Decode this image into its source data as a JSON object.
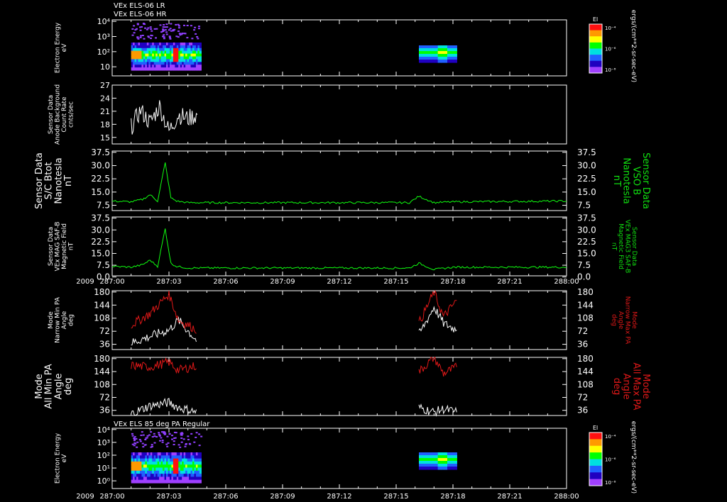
{
  "header": {
    "line1": "VEx ELS-06 LR",
    "line2": "VEx ELS-06 HR",
    "bottom_header": "VEx ELS 85 deg PA Regular"
  },
  "time_axis": {
    "year": "2009",
    "ticks": [
      "287:00",
      "287:03",
      "287:06",
      "287:09",
      "287:12",
      "287:15",
      "287:18",
      "287:21",
      "288:00"
    ]
  },
  "colorbar": {
    "label": "El",
    "units": "ergs/(cm**2-sr-sec-eV)",
    "ticks": [
      "10⁻⁴",
      "10⁻⁶",
      "10⁻⁸"
    ],
    "colors": [
      "#ff1010",
      "#ff9a00",
      "#ffff00",
      "#00ff00",
      "#00e0e0",
      "#2060ff",
      "#2000c0",
      "#a040ff"
    ]
  },
  "panels": [
    {
      "name": "electron-energy-top",
      "type": "spectrogram",
      "ylabel": [
        "Electron Energy",
        "eV"
      ],
      "yticks": [
        "10⁴",
        "10³",
        "10²",
        "10"
      ],
      "label_color": "#ffffff"
    },
    {
      "name": "anode-background",
      "type": "line",
      "ylabel": [
        "Sensor Data",
        "Anode Background",
        "Count Rate",
        "cnts/sec"
      ],
      "yticks": [
        "27",
        "24",
        "21",
        "18",
        "15"
      ],
      "ylim": [
        13,
        27
      ],
      "color": "#ffffff"
    },
    {
      "name": "sc-bnorm",
      "type": "line",
      "ylabel": [
        "Sensor Data",
        "S/C Btot",
        "Nanotesla",
        "nT"
      ],
      "yticks": [
        "37.5",
        "30.0",
        "22.5",
        "15.0",
        "7.5"
      ],
      "right_ticks": [
        "37.5",
        "30.0",
        "22.5",
        "15.0",
        "7.5"
      ],
      "right_label": [
        "Sensor Data",
        "VSO B",
        "Nanotesla",
        "nT"
      ],
      "ylim": [
        0,
        37.5
      ],
      "color": "#10ff10"
    },
    {
      "name": "mag-field",
      "type": "line",
      "ylabel": [
        "Sensor Data",
        "VEx MAG SAF-B",
        "Magnetic Field",
        "nT"
      ],
      "yticks": [
        "37.5",
        "30.0",
        "22.5",
        "15.0",
        "7.5",
        "0.0"
      ],
      "right_ticks": [
        "37.5",
        "30.0",
        "22.5",
        "15.0",
        "7.5",
        "0.0"
      ],
      "right_label": [
        "Sensor Data",
        "VEx MAG3 SAF-B",
        "Magnetic Field",
        "nT"
      ],
      "ylim": [
        0,
        37.5
      ],
      "color": "#10ff10"
    },
    {
      "name": "narrow-pa",
      "type": "line2",
      "ylabel": [
        "Mode",
        "Narrow Min PA",
        "Angle",
        "deg"
      ],
      "yticks": [
        "180",
        "144",
        "108",
        "72",
        "36"
      ],
      "right_ticks": [
        "180",
        "144",
        "108",
        "72",
        "36"
      ],
      "right_label": [
        "Mode",
        "Narrow Max PA",
        "Angle",
        "deg"
      ],
      "ylim": [
        0,
        180
      ]
    },
    {
      "name": "all-pa",
      "type": "line2",
      "ylabel": [
        "Mode",
        "All Min PA",
        "Angle",
        "deg"
      ],
      "yticks": [
        "180",
        "144",
        "108",
        "72",
        "36"
      ],
      "right_ticks": [
        "180",
        "144",
        "108",
        "72",
        "36"
      ],
      "right_label": [
        "Mode",
        "All Max PA",
        "Angle",
        "deg"
      ],
      "ylim": [
        0,
        180
      ]
    },
    {
      "name": "electron-energy-bottom",
      "type": "spectrogram",
      "ylabel": [
        "Electron Energy",
        "eV"
      ],
      "yticks": [
        "10⁴",
        "10³",
        "10²",
        "10¹",
        "10⁰"
      ],
      "label_color": "#ffffff"
    }
  ],
  "chart_data": {
    "type": "line",
    "x_range_hours": [
      0,
      24
    ],
    "series": [
      {
        "panel": "anode-background",
        "x": [
          1.0,
          1.5,
          2.0,
          2.5,
          3.0,
          3.5,
          4.0,
          4.5
        ],
        "y": [
          17,
          21,
          18,
          22,
          16,
          20,
          19,
          20
        ]
      },
      {
        "panel": "sc-bnorm",
        "x": [
          0,
          1.0,
          1.6,
          2.0,
          2.4,
          2.8,
          3.1,
          3.4,
          4.0,
          8,
          12,
          15.7,
          16.2,
          17.0,
          18,
          24
        ],
        "y": [
          6,
          5.5,
          7,
          10,
          6,
          30,
          8,
          6,
          5,
          5,
          5,
          5,
          9,
          5,
          5.5,
          6
        ]
      },
      {
        "panel": "mag-field",
        "x": [
          0,
          1.0,
          1.6,
          2.0,
          2.4,
          2.8,
          3.1,
          3.4,
          4.0,
          8,
          12,
          15.7,
          16.2,
          17.0,
          18,
          24
        ],
        "y": [
          6,
          5.5,
          7,
          10,
          6,
          30,
          8,
          6,
          5,
          5,
          5,
          5,
          8,
          4,
          5.5,
          5.5
        ]
      },
      {
        "panel": "narrow-pa",
        "name": "Narrow Min PA",
        "x": [
          1.0,
          2.0,
          3.0,
          3.5,
          4.5,
          16.2,
          17.0,
          17.5,
          18.2
        ],
        "y": [
          20,
          40,
          60,
          90,
          25,
          45,
          130,
          80,
          60
        ]
      },
      {
        "panel": "narrow-pa",
        "name": "Narrow Max PA",
        "x": [
          1.0,
          2.0,
          3.0,
          3.5,
          4.5,
          16.2,
          17.0,
          17.5,
          18.2
        ],
        "y": [
          75,
          110,
          170,
          90,
          60,
          80,
          175,
          100,
          150
        ]
      },
      {
        "panel": "all-pa",
        "name": "All Min PA",
        "x": [
          1.0,
          2.0,
          3.0,
          3.5,
          4.5,
          16.2,
          17.0,
          17.5,
          18.2
        ],
        "y": [
          5,
          30,
          40,
          25,
          10,
          25,
          10,
          20,
          10
        ]
      },
      {
        "panel": "all-pa",
        "name": "All Max PA",
        "x": [
          1.0,
          2.0,
          3.0,
          3.5,
          4.5,
          16.2,
          17.0,
          17.5,
          18.2
        ],
        "y": [
          155,
          150,
          165,
          140,
          155,
          135,
          180,
          130,
          150
        ]
      }
    ]
  }
}
